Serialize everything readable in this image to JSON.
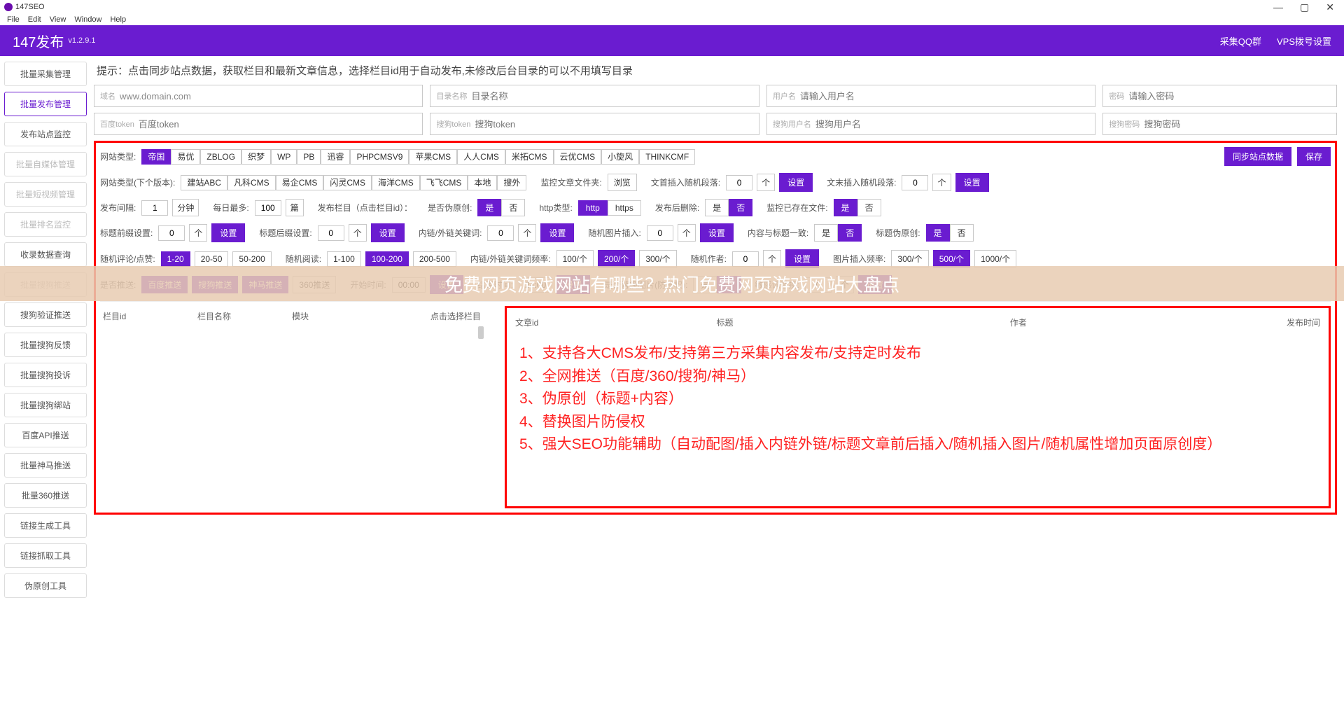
{
  "window": {
    "title": "147SEO",
    "min": "—",
    "max": "▢",
    "close": "✕"
  },
  "menubar": [
    "File",
    "Edit",
    "View",
    "Window",
    "Help"
  ],
  "header": {
    "title": "147发布",
    "version": "v1.2.9.1",
    "links": [
      "采集QQ群",
      "VPS拨号设置"
    ]
  },
  "sidebar": [
    {
      "label": "批量采集管理",
      "state": ""
    },
    {
      "label": "批量发布管理",
      "state": "active"
    },
    {
      "label": "发布站点监控",
      "state": ""
    },
    {
      "label": "批量自媒体管理",
      "state": "disabled"
    },
    {
      "label": "批量短视频管理",
      "state": "disabled"
    },
    {
      "label": "批量排名监控",
      "state": "disabled"
    },
    {
      "label": "收录数据查询",
      "state": ""
    },
    {
      "label": "批量搜狗推送",
      "state": "disabled"
    },
    {
      "label": "搜狗验证推送",
      "state": ""
    },
    {
      "label": "批量搜狗反馈",
      "state": ""
    },
    {
      "label": "批量搜狗投诉",
      "state": ""
    },
    {
      "label": "批量搜狗绑站",
      "state": ""
    },
    {
      "label": "百度API推送",
      "state": ""
    },
    {
      "label": "批量神马推送",
      "state": ""
    },
    {
      "label": "批量360推送",
      "state": ""
    },
    {
      "label": "链接生成工具",
      "state": ""
    },
    {
      "label": "链接抓取工具",
      "state": ""
    },
    {
      "label": "伪原创工具",
      "state": ""
    }
  ],
  "hint": "提示：点击同步站点数据，获取栏目和最新文章信息，选择栏目id用于自动发布,未修改后台目录的可以不用填写目录",
  "inputs": {
    "domain": {
      "label": "域名",
      "value": "www.domain.com"
    },
    "dir": {
      "label": "目录名称",
      "placeholder": "目录名称"
    },
    "user": {
      "label": "用户名",
      "placeholder": "请输入用户名"
    },
    "pass": {
      "label": "密码",
      "placeholder": "请输入密码"
    },
    "baidu_token": {
      "label": "百度token",
      "placeholder": "百度token"
    },
    "sogou_token": {
      "label": "搜狗token",
      "placeholder": "搜狗token"
    },
    "sogou_user": {
      "label": "搜狗用户名",
      "placeholder": "搜狗用户名"
    },
    "sogou_pass": {
      "label": "搜狗密码",
      "placeholder": "搜狗密码"
    }
  },
  "site_types_label": "网站类型:",
  "site_types": [
    "帝国",
    "易优",
    "ZBLOG",
    "织梦",
    "WP",
    "PB",
    "迅睿",
    "PHPCMSV9",
    "苹果CMS",
    "人人CMS",
    "米拓CMS",
    "云优CMS",
    "小旋风",
    "THINKCMF"
  ],
  "sync_btn": "同步站点数据",
  "save_btn": "保存",
  "next_ver_label": "网站类型(下个版本):",
  "next_ver_types": [
    "建站ABC",
    "凡科CMS",
    "易企CMS",
    "闪灵CMS",
    "海洋CMS",
    "飞飞CMS",
    "本地",
    "搜外"
  ],
  "monitor_folder": "监控文章文件夹:",
  "browse": "浏览",
  "head_rand": "文首插入随机段落:",
  "tail_rand": "文末插入随机段落:",
  "count_unit": "个",
  "set": "设置",
  "interval_label": "发布间隔:",
  "interval_val": "1",
  "minute": "分钟",
  "daily_label": "每日最多:",
  "daily_val": "100",
  "pian": "篇",
  "col_label": "发布栏目（点击栏目id）：",
  "pseudo_label": "是否伪原创:",
  "yes": "是",
  "no": "否",
  "http_label": "http类型:",
  "http": "http",
  "https": "https",
  "del_after": "发布后删除:",
  "monitor_exist": "监控已存在文件:",
  "prefix_label": "标题前缀设置:",
  "suffix_label": "标题后缀设置:",
  "link_kw": "内链/外链关键词:",
  "rand_img": "随机图片插入:",
  "title_same": "内容与标题一致:",
  "title_pseudo": "标题伪原创:",
  "comment_label": "随机评论/点赞:",
  "comment_opts": [
    "1-20",
    "20-50",
    "50-200"
  ],
  "read_label": "随机阅读:",
  "read_opts": [
    "1-100",
    "100-200",
    "200-500"
  ],
  "link_freq": "内链/外链关键词频率:",
  "freq_opts": [
    "100/个",
    "200/个",
    "300/个"
  ],
  "author_label": "随机作者:",
  "img_freq": "图片插入频率:",
  "img_freq_opts": [
    "300/个",
    "500/个",
    "1000/个"
  ],
  "push_label": "是否推送:",
  "push_opts": [
    "百度推送",
    "搜狗推送",
    "神马推送",
    "360推送"
  ],
  "start_time": "开始时间:",
  "start_val": "00:00",
  "end_time": "结束时间:",
  "end_val": "24:00",
  "replace_img": "是否替换图片(防侵权):",
  "sensitive": "敏感词替换:",
  "table_left": [
    "栏目id",
    "栏目名称",
    "模块",
    "点击选择栏目"
  ],
  "table_right": [
    "文章id",
    "标题",
    "作者",
    "发布时间"
  ],
  "features": [
    "1、支持各大CMS发布/支持第三方采集内容发布/支持定时发布",
    "2、全网推送（百度/360/搜狗/神马）",
    "3、伪原创（标题+内容）",
    "4、替换图片防侵权",
    "5、强大SEO功能辅助（自动配图/插入内链外链/标题文章前后插入/随机插入图片/随机属性增加页面原创度）"
  ],
  "watermark": "免费网页游戏网站有哪些？热门免费网页游戏网站大盘点",
  "zero": "0"
}
